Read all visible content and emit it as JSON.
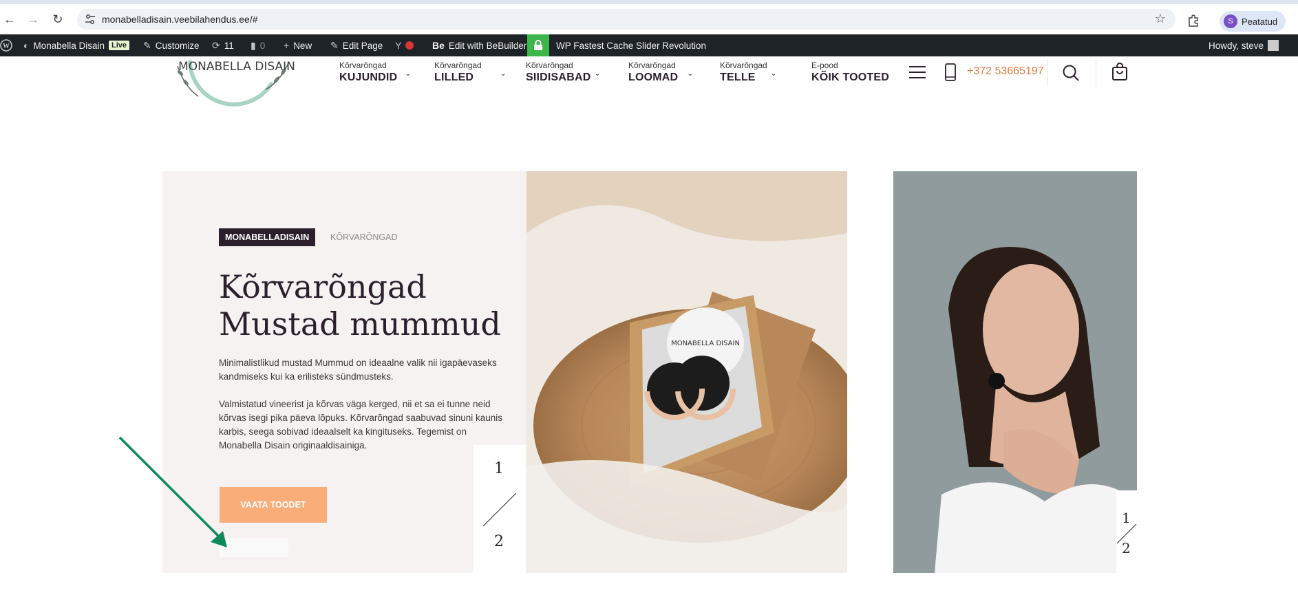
{
  "browser": {
    "url": "monabelladisain.veebilahendus.ee/#",
    "profile_initial": "S",
    "profile_label": "Peatatud"
  },
  "adminbar": {
    "site_name": "Monabella Disain",
    "live_badge": "Live",
    "customize": "Customize",
    "updates_count": "11",
    "comments_count": "0",
    "new_label": "New",
    "edit_page": "Edit Page",
    "bebuilder_logo": "Be",
    "bebuilder": "Edit with BeBuilder",
    "fastest_cache": "WP Fastest Cache",
    "slider_rev": "Slider Revolution",
    "howdy": "Howdy, steve"
  },
  "header": {
    "logo_text": "MONABELLA DISAIN",
    "menu": [
      {
        "small": "Kõrvarõngad",
        "large": "KUJUNDID",
        "has_dropdown": true
      },
      {
        "small": "Kõrvarõngad",
        "large": "LILLED",
        "has_dropdown": true
      },
      {
        "small": "Kõrvarõngad",
        "large": "SIIDISABAD",
        "has_dropdown": true
      },
      {
        "small": "Kõrvarõngad",
        "large": "LOOMAD",
        "has_dropdown": true
      },
      {
        "small": "Kõrvarõngad",
        "large": "TELLE",
        "has_dropdown": true
      },
      {
        "small": "E-pood",
        "large": "KÕIK TOOTED",
        "has_dropdown": false
      }
    ],
    "phone": "+372 53665197"
  },
  "hero": {
    "tag_primary": "MONABELLADISAIN",
    "tag_secondary": "KÕRVARÕNGAD",
    "title_line1": "Kõrvarõngad",
    "title_line2": "Mustad mummud",
    "paragraph1": "Minimalistlikud mustad Mummud on ideaalne valik nii igapäevaseks kandmiseks kui ka erilisteks sündmusteks.",
    "paragraph2": "Valmistatud vineerist ja kõrvas väga kerged, nii et sa ei tunne neid kõrvas isegi pika päeva lõpuks. Kõrvarõngad saabuvad sinuni kaunis karbis, seega sobivad ideaalselt ka kingituseks. Tegemist on Monabella Disain originaaldisainiga.",
    "cta": "VAATA TOODET",
    "pager_current": "1",
    "pager_total": "2",
    "box_brand": "MONABELLA DISAIN"
  },
  "colors": {
    "accent": "#f9ae7a",
    "dark": "#2b1f2c",
    "phone": "#e07b45",
    "arrow": "#0e8a5a"
  }
}
